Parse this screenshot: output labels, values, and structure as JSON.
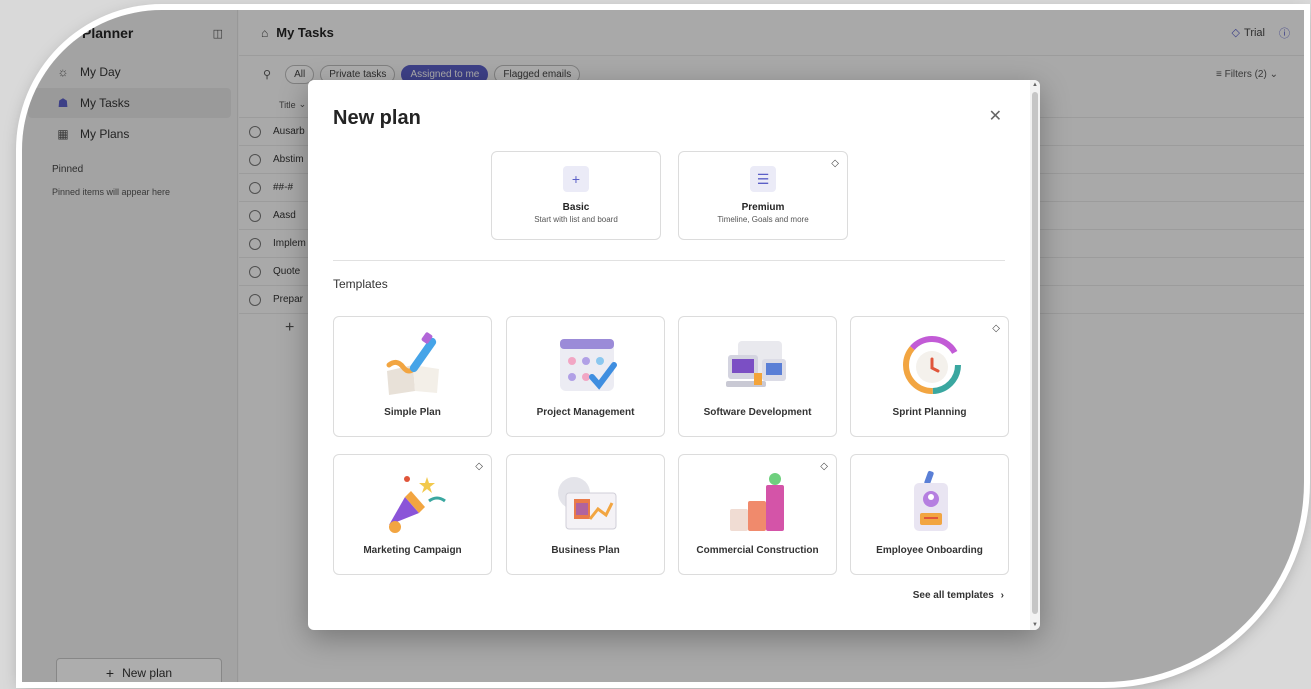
{
  "sidebar": {
    "app_title": "Planner",
    "items": [
      {
        "label": "My Day",
        "icon": "sun-icon"
      },
      {
        "label": "My Tasks",
        "icon": "tasks-icon"
      },
      {
        "label": "My Plans",
        "icon": "grid-icon"
      }
    ],
    "pinned_title": "Pinned",
    "pinned_note": "Pinned items will appear here",
    "new_plan_label": "New plan"
  },
  "main": {
    "title": "My Tasks",
    "trial_label": "Trial",
    "filters": [
      "All",
      "Private tasks",
      "Assigned to me",
      "Flagged emails"
    ],
    "active_filter": "Assigned to me",
    "filters_label": "Filters (2)",
    "column_title": "Title",
    "tasks": [
      "Ausarb",
      "Abstim",
      "##-#",
      "Aasd",
      "Implem",
      "Quote",
      "Prepar"
    ]
  },
  "dialog": {
    "title": "New plan",
    "plan_types": [
      {
        "name": "Basic",
        "desc": "Start with list and board",
        "premium": false
      },
      {
        "name": "Premium",
        "desc": "Timeline, Goals and more",
        "premium": true
      }
    ],
    "templates_label": "Templates",
    "templates": [
      {
        "name": "Simple Plan",
        "premium": false
      },
      {
        "name": "Project Management",
        "premium": false
      },
      {
        "name": "Software Development",
        "premium": false
      },
      {
        "name": "Sprint Planning",
        "premium": true
      },
      {
        "name": "Marketing Campaign",
        "premium": true
      },
      {
        "name": "Business Plan",
        "premium": false
      },
      {
        "name": "Commercial Construction",
        "premium": true
      },
      {
        "name": "Employee Onboarding",
        "premium": false
      }
    ],
    "see_all_label": "See all templates"
  },
  "colors": {
    "accent": "#5b5fc7"
  }
}
